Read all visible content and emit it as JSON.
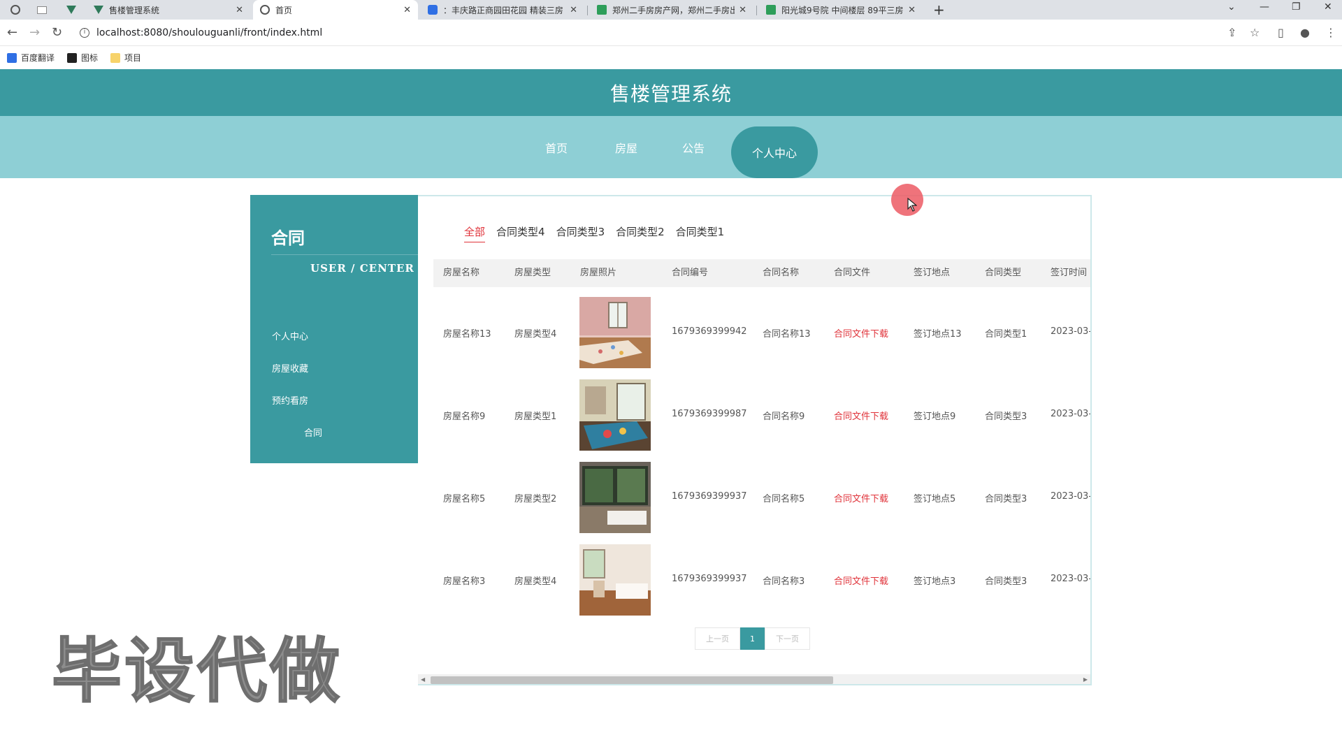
{
  "browser": {
    "tabs": [
      {
        "title": "售楼管理系统",
        "favicon": "vue-icon"
      },
      {
        "title": "首页",
        "favicon": "globe-icon",
        "active": true
      },
      {
        "title": "：丰庆路正商园田花园 精装三房",
        "favicon": "blue-logo-icon"
      },
      {
        "title": "郑州二手房房产网，郑州二手房出",
        "favicon": "green-logo-icon"
      },
      {
        "title": "阳光城9号院 中间楼层 89平三房",
        "favicon": "green-logo-icon"
      }
    ],
    "url": "localhost:8080/shoulouguanli/front/index.html",
    "bookmarks": [
      "百度翻译",
      "图标",
      "项目"
    ]
  },
  "site": {
    "title": "售楼管理系统",
    "nav": [
      "首页",
      "房屋",
      "公告",
      "个人中心"
    ],
    "active_nav": "个人中心"
  },
  "sidebar": {
    "title": "合同",
    "subtitle": "USER / CENTER",
    "items": [
      "个人中心",
      "房屋收藏",
      "预约看房",
      "合同"
    ]
  },
  "filters": [
    "全部",
    "合同类型4",
    "合同类型3",
    "合同类型2",
    "合同类型1"
  ],
  "active_filter": "全部",
  "table": {
    "headers": [
      "房屋名称",
      "房屋类型",
      "房屋照片",
      "合同编号",
      "合同名称",
      "合同文件",
      "签订地点",
      "合同类型",
      "签订时间"
    ],
    "rows": [
      {
        "name": "房屋名称13",
        "type": "房屋类型4",
        "contract_no": "1679369399942",
        "contract_name": "合同名称13",
        "file": "合同文件下载",
        "place": "签订地点13",
        "ctype": "合同类型1",
        "time": "2023-03-"
      },
      {
        "name": "房屋名称9",
        "type": "房屋类型1",
        "contract_no": "1679369399987",
        "contract_name": "合同名称9",
        "file": "合同文件下载",
        "place": "签订地点9",
        "ctype": "合同类型3",
        "time": "2023-03-"
      },
      {
        "name": "房屋名称5",
        "type": "房屋类型2",
        "contract_no": "1679369399937",
        "contract_name": "合同名称5",
        "file": "合同文件下载",
        "place": "签订地点5",
        "ctype": "合同类型3",
        "time": "2023-03-"
      },
      {
        "name": "房屋名称3",
        "type": "房屋类型4",
        "contract_no": "1679369399937",
        "contract_name": "合同名称3",
        "file": "合同文件下载",
        "place": "签订地点3",
        "ctype": "合同类型3",
        "time": "2023-03-"
      }
    ]
  },
  "pager": {
    "prev": "上一页",
    "current": "1",
    "next": "下一页"
  },
  "watermark": "毕设代做",
  "colors": {
    "primary": "#3a9aa0",
    "nav_bg": "#8ecfd5",
    "link": "#e0333a"
  }
}
